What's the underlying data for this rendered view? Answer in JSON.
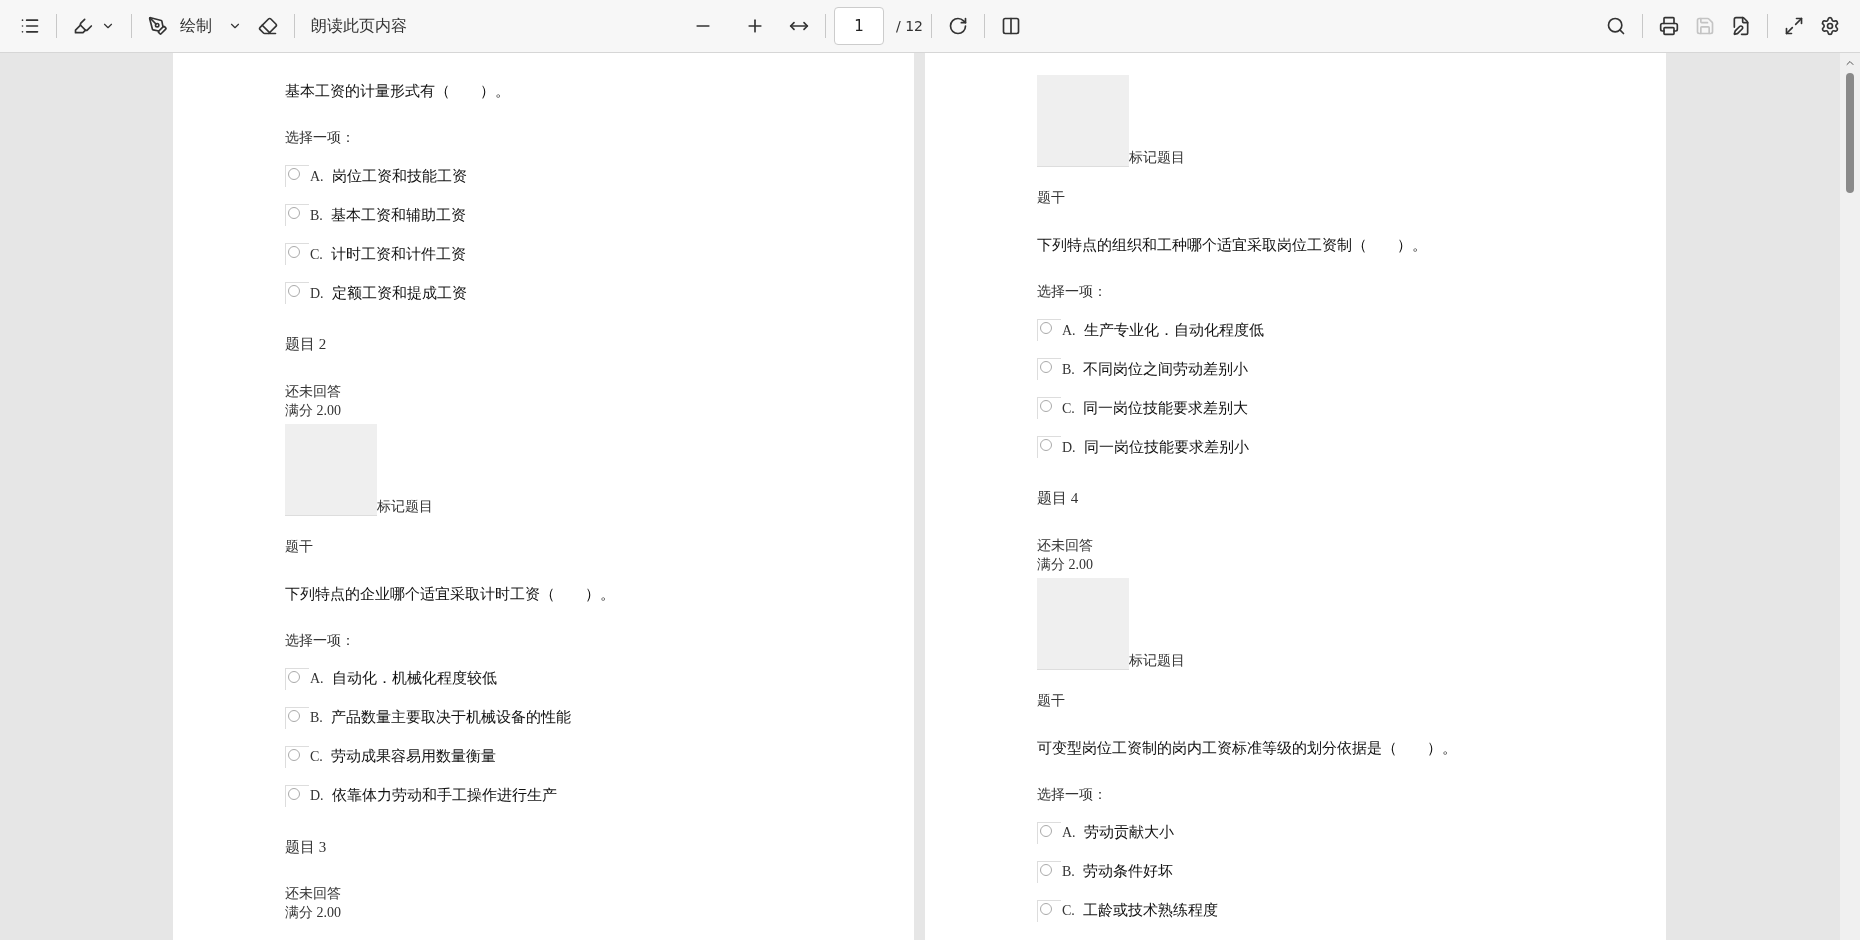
{
  "toolbar": {
    "draw_label": "绘制",
    "read_aloud": "朗读此页内容",
    "page_number": "1",
    "page_total": "/ 12",
    "save": {
      "disabled": true
    }
  },
  "pages": [
    {
      "blocks": [
        {
          "kind": "question",
          "text": "基本工资的计量形式有（　　）。"
        },
        {
          "kind": "prompt",
          "text": "选择一项："
        },
        {
          "kind": "option",
          "letter": "A.",
          "text": "岗位工资和技能工资",
          "selected": false
        },
        {
          "kind": "option",
          "letter": "B.",
          "text": "基本工资和辅助工资",
          "selected": false
        },
        {
          "kind": "option",
          "letter": "C.",
          "text": "计时工资和计件工资",
          "selected": false
        },
        {
          "kind": "option",
          "letter": "D.",
          "text": "定额工资和提成工资",
          "selected": false
        },
        {
          "kind": "heading",
          "text": "题目 2"
        },
        {
          "kind": "status",
          "lines": [
            "还未回答",
            "满分 2.00"
          ]
        },
        {
          "kind": "flag",
          "text": "标记题目"
        },
        {
          "kind": "label",
          "text": "题干"
        },
        {
          "kind": "question",
          "text": "下列特点的企业哪个适宜采取计时工资（　　）。"
        },
        {
          "kind": "prompt",
          "text": "选择一项："
        },
        {
          "kind": "option",
          "letter": "A.",
          "text": "自动化．机械化程度较低",
          "selected": false
        },
        {
          "kind": "option",
          "letter": "B.",
          "text": "产品数量主要取决于机械设备的性能",
          "selected": false
        },
        {
          "kind": "option",
          "letter": "C.",
          "text": "劳动成果容易用数量衡量",
          "selected": false
        },
        {
          "kind": "option",
          "letter": "D.",
          "text": "依靠体力劳动和手工操作进行生产",
          "selected": false
        },
        {
          "kind": "heading",
          "text": "题目 3"
        },
        {
          "kind": "status",
          "lines": [
            "还未回答",
            "满分 2.00"
          ]
        }
      ]
    },
    {
      "blocks": [
        {
          "kind": "flag",
          "text": "标记题目"
        },
        {
          "kind": "label",
          "text": "题干"
        },
        {
          "kind": "question",
          "text": "下列特点的组织和工种哪个适宜采取岗位工资制（　　）。"
        },
        {
          "kind": "prompt",
          "text": "选择一项："
        },
        {
          "kind": "option",
          "letter": "A.",
          "text": "生产专业化．自动化程度低",
          "selected": false
        },
        {
          "kind": "option",
          "letter": "B.",
          "text": "不同岗位之间劳动差别小",
          "selected": false
        },
        {
          "kind": "option",
          "letter": "C.",
          "text": "同一岗位技能要求差别大",
          "selected": false
        },
        {
          "kind": "option",
          "letter": "D.",
          "text": "同一岗位技能要求差别小",
          "selected": false
        },
        {
          "kind": "heading",
          "text": "题目 4"
        },
        {
          "kind": "status",
          "lines": [
            "还未回答",
            "满分 2.00"
          ]
        },
        {
          "kind": "flag",
          "text": "标记题目"
        },
        {
          "kind": "label",
          "text": "题干"
        },
        {
          "kind": "question",
          "text": "可变型岗位工资制的岗内工资标准等级的划分依据是（　　）。"
        },
        {
          "kind": "prompt",
          "text": "选择一项："
        },
        {
          "kind": "option",
          "letter": "A.",
          "text": "劳动贡献大小",
          "selected": false
        },
        {
          "kind": "option",
          "letter": "B.",
          "text": "劳动条件好坏",
          "selected": false
        },
        {
          "kind": "option",
          "letter": "C.",
          "text": "工龄或技术熟练程度",
          "selected": false
        }
      ]
    }
  ]
}
